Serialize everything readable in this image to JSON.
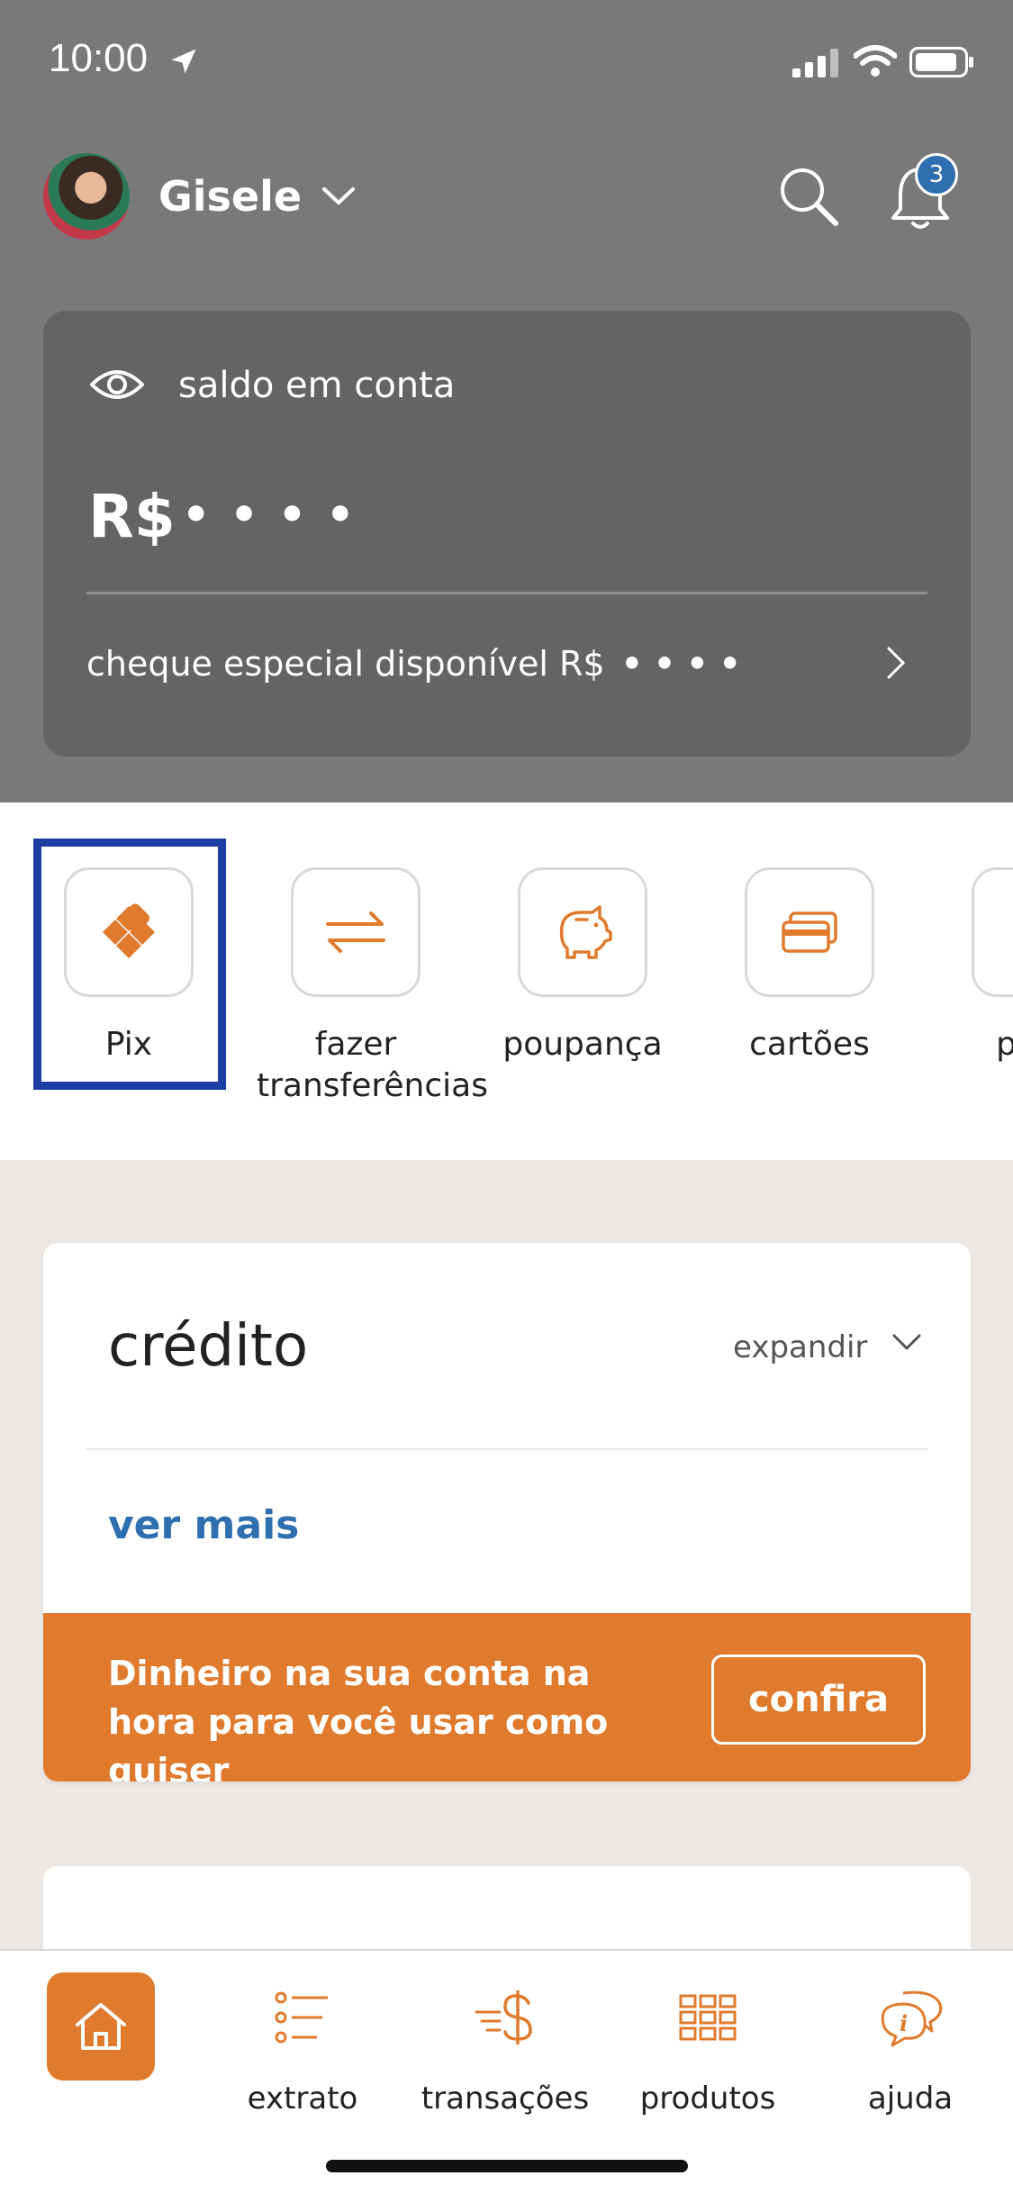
{
  "status_bar": {
    "time": "10:00"
  },
  "header": {
    "user_name": "Gisele",
    "notification_count": "3"
  },
  "balance": {
    "label": "saldo em conta",
    "currency": "R$",
    "masked_value": "••••",
    "overdraft_label": "cheque especial disponível R$",
    "overdraft_masked": "••••"
  },
  "shortcuts": [
    {
      "label": "Pix",
      "icon": "pix-icon"
    },
    {
      "label": "fazer transferências",
      "icon": "transfer-icon"
    },
    {
      "label": "poupança",
      "icon": "piggy-bank-icon"
    },
    {
      "label": "cartões",
      "icon": "cards-icon"
    },
    {
      "label": "paga",
      "icon": "payment-icon"
    }
  ],
  "credit": {
    "title": "crédito",
    "expand_label": "expandir",
    "see_more": "ver mais",
    "promo_text": "Dinheiro na sua conta na hora para você usar como quiser",
    "promo_cta": "confira"
  },
  "nav": {
    "items": [
      {
        "label": "",
        "icon": "home-icon"
      },
      {
        "label": "extrato",
        "icon": "statement-icon"
      },
      {
        "label": "transações",
        "icon": "transactions-icon"
      },
      {
        "label": "produtos",
        "icon": "products-icon"
      },
      {
        "label": "ajuda",
        "icon": "help-icon"
      }
    ]
  },
  "colors": {
    "accent": "#e07b2e",
    "link": "#2f6fb0",
    "highlight": "#1d3fa3",
    "header_bg": "#797979",
    "card_bg": "#646464"
  }
}
